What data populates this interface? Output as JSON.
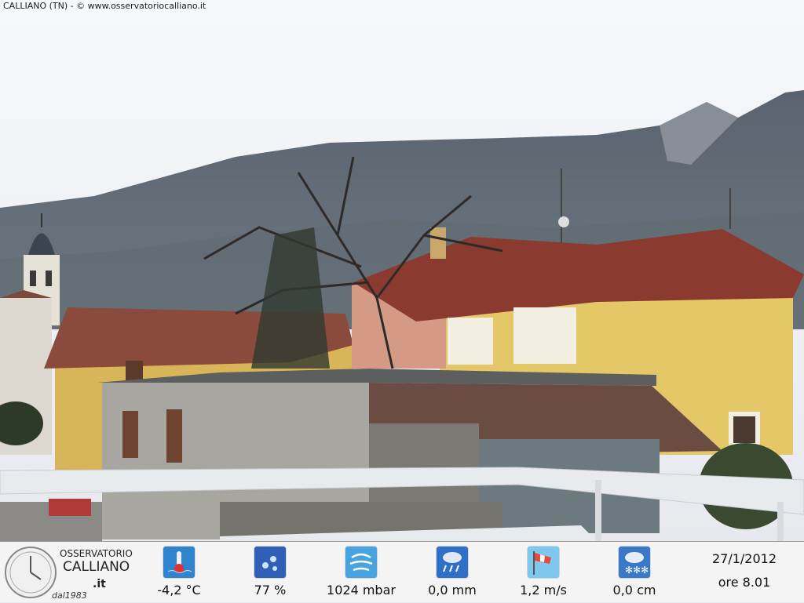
{
  "caption": "CALLIANO (TN) - © www.osservatoriocalliano.it",
  "logo": {
    "line1": "OSSERVATORIO",
    "line2": "CALLIANO",
    "line3": ".it",
    "since": "dal1983"
  },
  "readings": {
    "temperature": {
      "icon": "thermometer-icon",
      "value": "-4,2 °C"
    },
    "humidity": {
      "icon": "humidity-drops-icon",
      "value": "77 %"
    },
    "pressure": {
      "icon": "pressure-wind-icon",
      "value": "1024 mbar"
    },
    "rain": {
      "icon": "rain-cloud-icon",
      "value": "0,0 mm"
    },
    "wind": {
      "icon": "windsock-icon",
      "value": "1,2 m/s"
    },
    "snow": {
      "icon": "snow-cloud-icon",
      "value": "0,0 cm"
    }
  },
  "datetime": {
    "date": "27/1/2012",
    "time": "ore 8.01"
  },
  "colors": {
    "icon_blue": "#2f84d0",
    "bar_bg": "#f4f4f4",
    "sky": "#eef0f4",
    "wall_yellow": "#e4c766",
    "roof": "#8a3a2e"
  }
}
